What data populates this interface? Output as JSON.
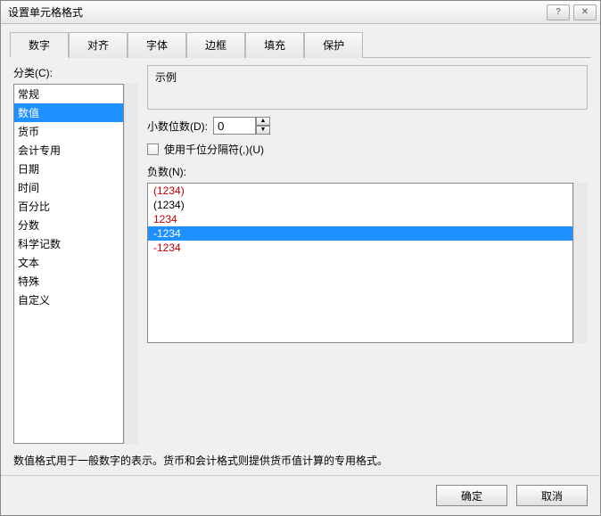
{
  "title": "设置单元格格式",
  "help": "?",
  "close": "✕",
  "tabs": {
    "number": "数字",
    "align": "对齐",
    "font": "字体",
    "border": "边框",
    "fill": "填充",
    "protect": "保护"
  },
  "category": {
    "label": "分类(C):",
    "items": {
      "general": "常规",
      "number": "数值",
      "currency": "货币",
      "accounting": "会计专用",
      "date": "日期",
      "time": "时间",
      "percent": "百分比",
      "fraction": "分数",
      "sci": "科学记数",
      "text": "文本",
      "special": "特殊",
      "custom": "自定义"
    }
  },
  "preview": {
    "label": "示例",
    "value": ""
  },
  "decimals": {
    "label": "小数位数(D):",
    "value": "0"
  },
  "thousands": {
    "label": "使用千位分隔符(,)(U)"
  },
  "negatives": {
    "label": "负数(N):",
    "items": {
      "n0": "(1234)",
      "n1": "(1234)",
      "n2": "1234",
      "n3": "-1234",
      "n4": "-1234"
    }
  },
  "description": "数值格式用于一般数字的表示。货币和会计格式则提供货币值计算的专用格式。",
  "footer": {
    "ok": "确定",
    "cancel": "取消"
  }
}
